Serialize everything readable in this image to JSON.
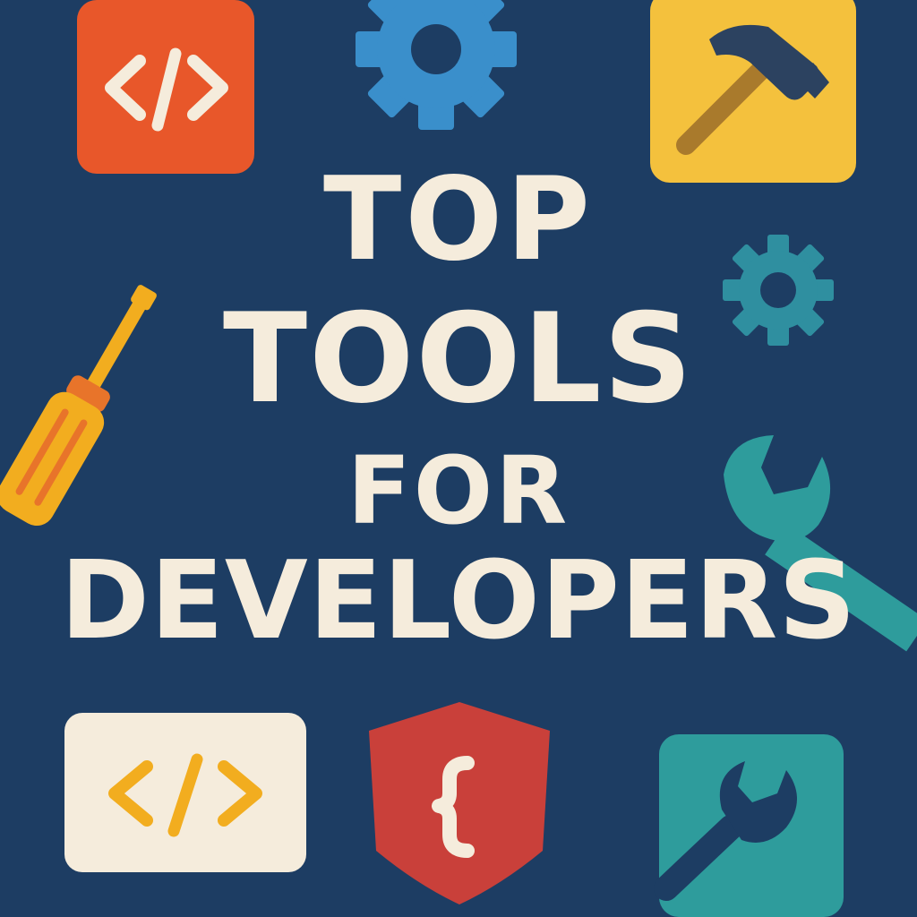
{
  "title": {
    "line1": "TOP",
    "line2": "TOOLS",
    "line3": "FOR",
    "line4": "DEVELOPERS"
  },
  "colors": {
    "background": "#1d3d63",
    "title_text": "#f5ecdc",
    "orange": "#e8572a",
    "blue": "#3a8fcb",
    "yellow": "#f4c13d",
    "teal": "#2f8fa0",
    "green_teal": "#2e9c9c",
    "cream": "#f5ecdc",
    "red": "#c9403a",
    "screwdriver": "#f2ad1f"
  },
  "icons": [
    "code-tag-icon",
    "gear-icon",
    "hammer-icon",
    "screwdriver-icon",
    "small-gear-icon",
    "wrench-icon",
    "code-card-icon",
    "curly-brace-shield-icon",
    "wrench-tile-icon"
  ]
}
